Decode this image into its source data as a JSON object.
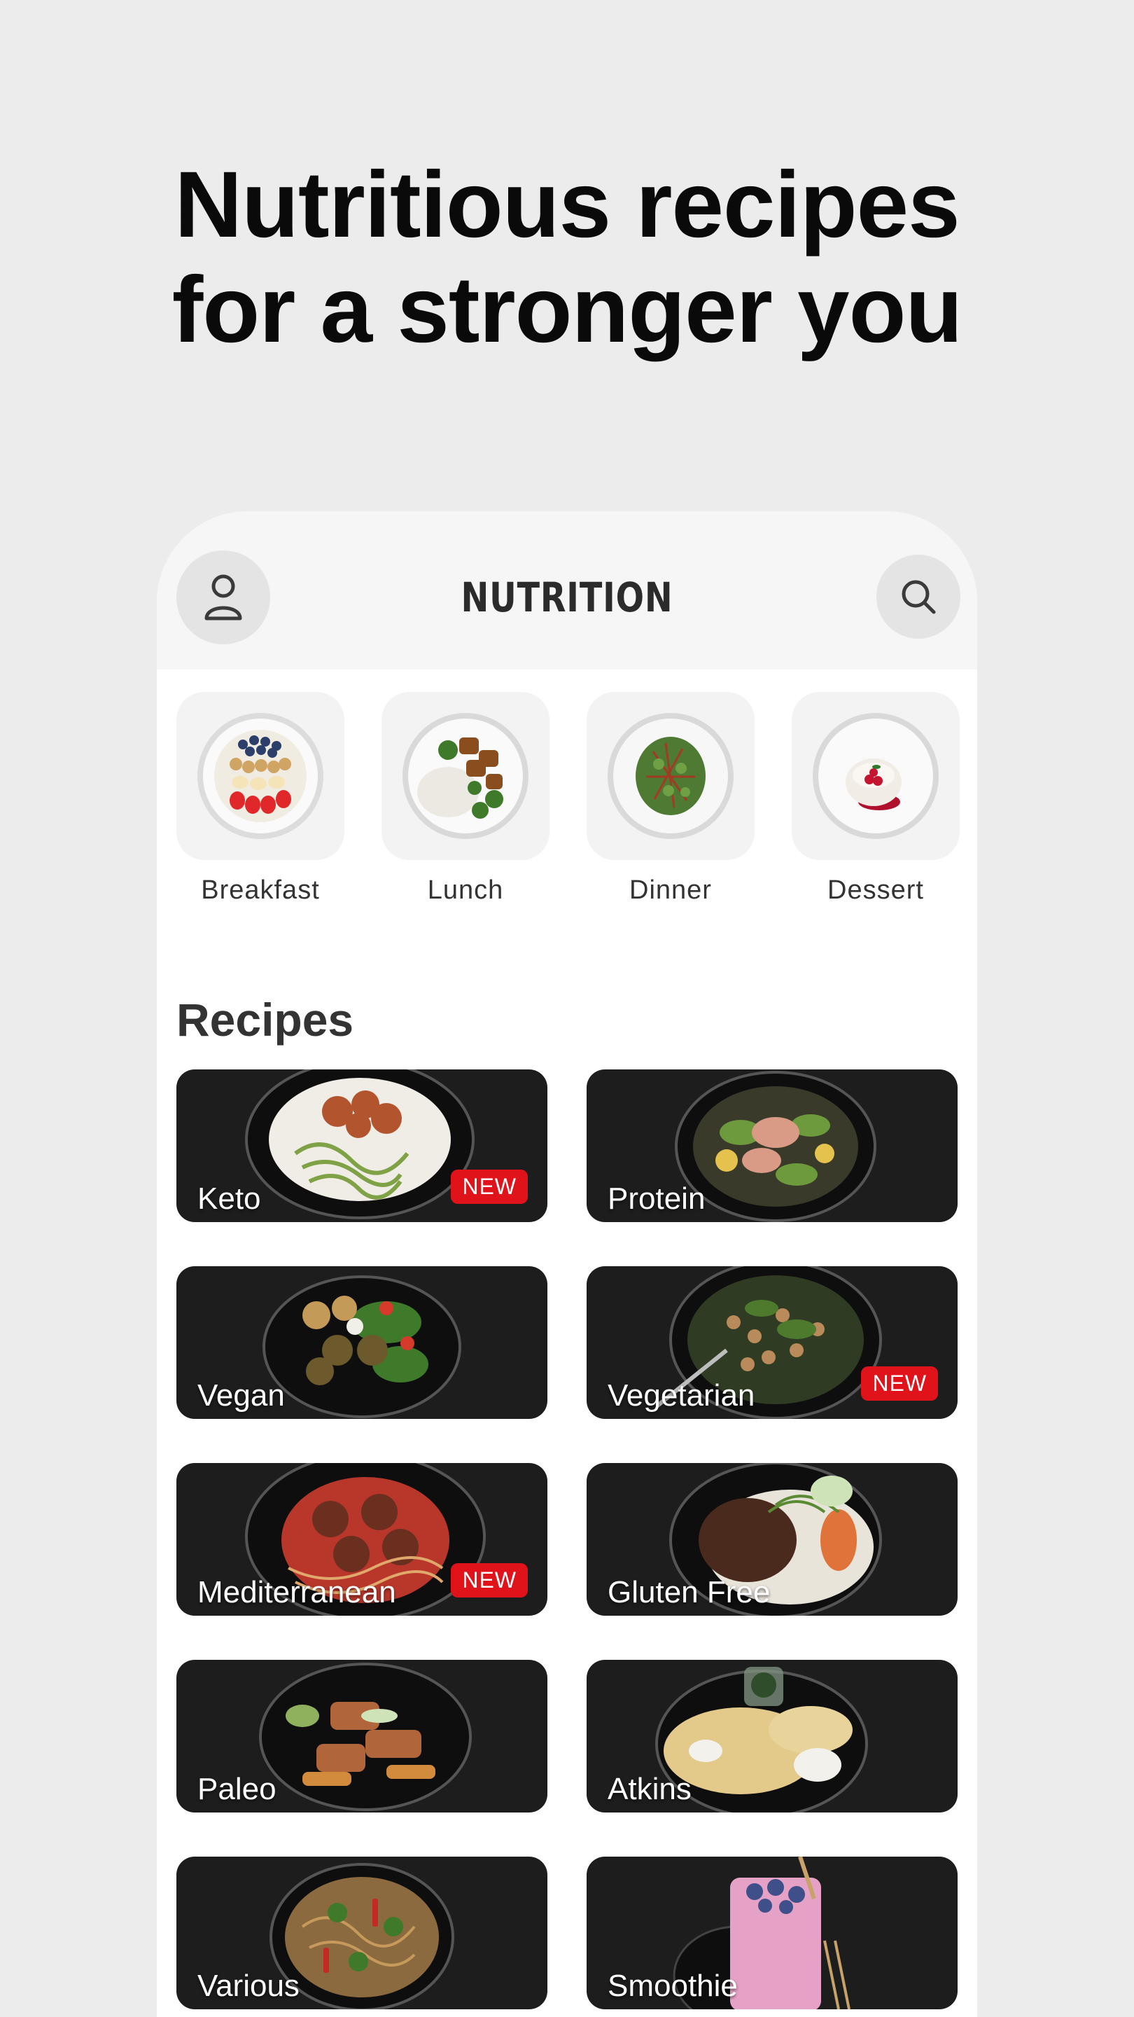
{
  "hero": {
    "line1": "Nutritious recipes",
    "line2": "for a stronger you"
  },
  "header": {
    "title": "NUTRITION",
    "profile_icon": "person-icon",
    "search_icon": "search-icon"
  },
  "meals": [
    {
      "label": "Breakfast",
      "icon": "yogurt-bowl"
    },
    {
      "label": "Lunch",
      "icon": "rice-broccoli-plate"
    },
    {
      "label": "Dinner",
      "icon": "salad-plate"
    },
    {
      "label": "Dessert",
      "icon": "panna-cotta"
    }
  ],
  "recipes_section": {
    "title": "Recipes",
    "badge_label": "NEW",
    "items": [
      {
        "label": "Keto",
        "is_new": true
      },
      {
        "label": "Protein",
        "is_new": false
      },
      {
        "label": "Vegan",
        "is_new": false
      },
      {
        "label": "Vegetarian",
        "is_new": true
      },
      {
        "label": "Mediterranean",
        "is_new": true
      },
      {
        "label": "Gluten Free",
        "is_new": false
      },
      {
        "label": "Paleo",
        "is_new": false
      },
      {
        "label": "Atkins",
        "is_new": false
      },
      {
        "label": "Various",
        "is_new": false
      },
      {
        "label": "Smoothie",
        "is_new": false
      }
    ]
  },
  "colors": {
    "background": "#ececec",
    "badge": "#e0131b",
    "card": "#1d1d1d",
    "header": "#f6f6f6"
  }
}
